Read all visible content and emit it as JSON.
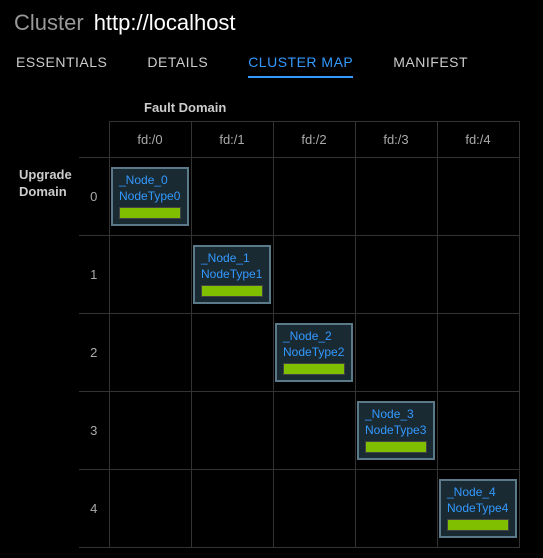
{
  "header": {
    "label": "Cluster",
    "url": "http://localhost"
  },
  "tabs": [
    {
      "label": "ESSENTIALS",
      "active": false
    },
    {
      "label": "DETAILS",
      "active": false
    },
    {
      "label": "CLUSTER MAP",
      "active": true
    },
    {
      "label": "MANIFEST",
      "active": false
    }
  ],
  "grid": {
    "fault_domain_label": "Fault Domain",
    "upgrade_domain_label": "Upgrade Domain",
    "fault_domains": [
      "fd:/0",
      "fd:/1",
      "fd:/2",
      "fd:/3",
      "fd:/4"
    ],
    "upgrade_domains": [
      "0",
      "1",
      "2",
      "3",
      "4"
    ],
    "nodes": [
      {
        "ud": 0,
        "fd": 0,
        "name": "_Node_0",
        "type": "NodeType0"
      },
      {
        "ud": 1,
        "fd": 1,
        "name": "_Node_1",
        "type": "NodeType1"
      },
      {
        "ud": 2,
        "fd": 2,
        "name": "_Node_2",
        "type": "NodeType2"
      },
      {
        "ud": 3,
        "fd": 3,
        "name": "_Node_3",
        "type": "NodeType3"
      },
      {
        "ud": 4,
        "fd": 4,
        "name": "_Node_4",
        "type": "NodeType4"
      }
    ]
  },
  "colors": {
    "accent": "#3399ff",
    "health_ok": "#7fbf00",
    "node_border": "#5a7a8a"
  }
}
